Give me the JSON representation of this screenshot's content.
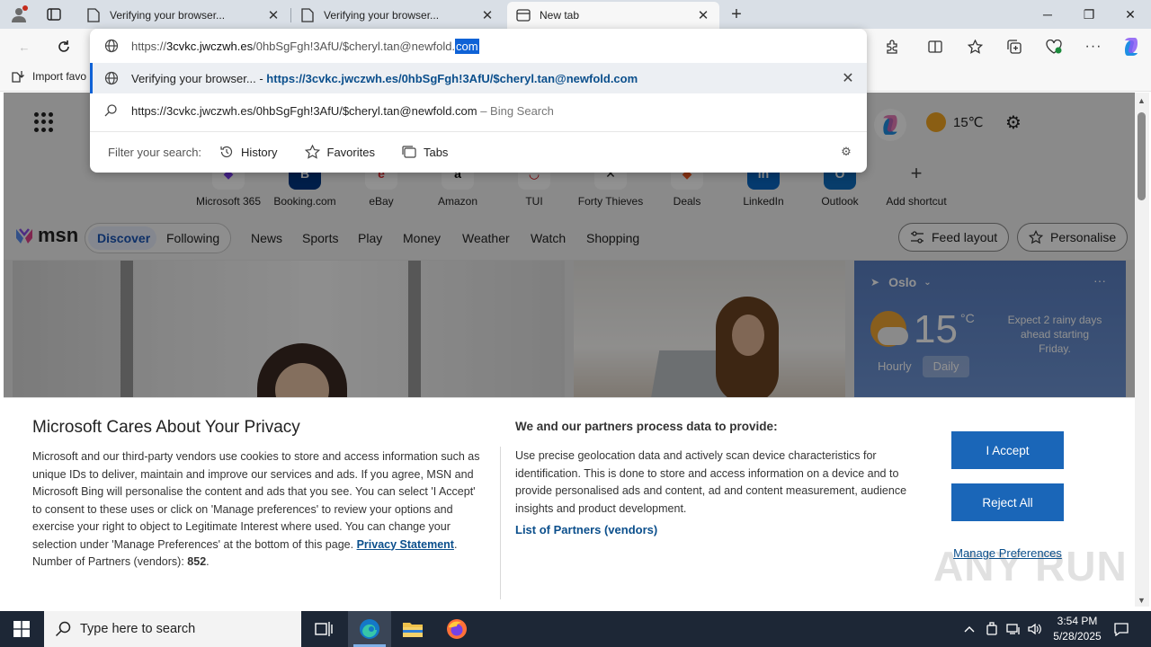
{
  "browser": {
    "tabs": [
      {
        "title": "Verifying your browser...",
        "active": false
      },
      {
        "title": "Verifying your browser...",
        "active": false
      },
      {
        "title": "New tab",
        "active": true
      }
    ]
  },
  "favorites_bar": {
    "import_label": "Import favo"
  },
  "omnibox": {
    "url_prefix": "https://",
    "url_host": "3cvkc.jwczwh.es",
    "url_rest": "/0hbSgFgh!3AfU/$cheryl.tan@newfold.",
    "url_selected": "com",
    "suggestion1_title": "Verifying your browser...",
    "suggestion1_sep": " - ",
    "suggestion1_url": "https://3cvkc.jwczwh.es/0hbSgFgh!3AfU/$cheryl.tan@newfold.com",
    "suggestion2_text": "https://3cvkc.jwczwh.es/0hbSgFgh!3AfU/$cheryl.tan@newfold.com",
    "suggestion2_suffix": " – Bing Search",
    "filter_label": "Filter your search:",
    "filters": [
      "History",
      "Favorites",
      "Tabs"
    ]
  },
  "newtab": {
    "weather_top": "15℃",
    "shortcuts": [
      "Microsoft 365",
      "Booking.com",
      "eBay",
      "Amazon",
      "TUI",
      "Forty Thieves",
      "Deals",
      "LinkedIn",
      "Outlook",
      "Add shortcut"
    ],
    "msn_logo": "msn",
    "nav": {
      "discover": "Discover",
      "following": "Following",
      "items": [
        "News",
        "Sports",
        "Play",
        "Money",
        "Weather",
        "Watch",
        "Shopping"
      ]
    },
    "feed_layout": "Feed layout",
    "personalise": "Personalise",
    "weather_card": {
      "location": "Oslo",
      "temp": "15",
      "unit": "°C",
      "desc": "Expect 2 rainy days ahead starting Friday.",
      "tabs": [
        "Hourly",
        "Daily"
      ]
    }
  },
  "privacy": {
    "title": "Microsoft Cares About Your Privacy",
    "body": "Microsoft and our third-party vendors use cookies to store and access information such as unique IDs to deliver, maintain and improve our services and ads. If you agree, MSN and Microsoft Bing will personalise the content and ads that you see. You can select 'I Accept' to consent to these uses or click on 'Manage preferences' to review your options and exercise your right to object to Legitimate Interest where used.  You can change your selection under 'Manage Preferences' at the bottom of this page.",
    "privacy_link": "Privacy Statement",
    "partners_label": "Number of Partners (vendors): ",
    "partners_count": "852",
    "h2": "We and our partners process data to provide:",
    "body2": "Use precise geolocation data and actively scan device characteristics for identification. This is done to store and access information on a device and to provide personalised ads and content, ad and content measurement, audience insights and product development.",
    "partners_link": "List of Partners (vendors)",
    "accept": "I Accept",
    "reject": "Reject All",
    "manage": "Manage Preferences",
    "watermark": "ANY RUN"
  },
  "taskbar": {
    "search_placeholder": "Type here to search",
    "time": "3:54 PM",
    "date": "5/28/2025"
  }
}
